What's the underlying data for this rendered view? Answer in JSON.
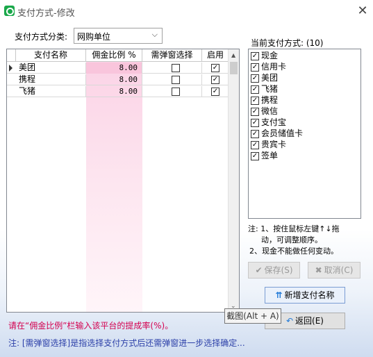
{
  "window": {
    "title": "支付方式-修改",
    "close_glyph": "✕"
  },
  "category": {
    "label": "支付方式分类:",
    "value": "网购单位"
  },
  "table": {
    "headers": [
      "支付名称",
      "佣金比例 %",
      "需弹窗选择",
      "启用"
    ],
    "rows": [
      {
        "name": "美团",
        "rate": "8.00",
        "popup": false,
        "enabled": true
      },
      {
        "name": "携程",
        "rate": "8.00",
        "popup": false,
        "enabled": true
      },
      {
        "name": "飞猪",
        "rate": "8.00",
        "popup": false,
        "enabled": true
      }
    ]
  },
  "current": {
    "title": "当前支付方式: (10)",
    "items": [
      {
        "label": "现金",
        "checked": true
      },
      {
        "label": "信用卡",
        "checked": true
      },
      {
        "label": "美团",
        "checked": true
      },
      {
        "label": "飞猪",
        "checked": true
      },
      {
        "label": "携程",
        "checked": true
      },
      {
        "label": "微信",
        "checked": true
      },
      {
        "label": "支付宝",
        "checked": true
      },
      {
        "label": "会员储值卡",
        "checked": true
      },
      {
        "label": "贵宾卡",
        "checked": true
      },
      {
        "label": "签单",
        "checked": true
      }
    ]
  },
  "notes": {
    "line1": "注: 1、按住鼠标左键↑↓拖",
    "line2": "动，可调整顺序。",
    "line3": "2、现金不能做任何变动。"
  },
  "buttons": {
    "save": "保存(S)",
    "cancel": "取消(C)",
    "add": "新增支付名称",
    "back": "返回(E)"
  },
  "tooltip": "截图(Alt + A)",
  "footer": {
    "red": "请在“佣金比例”栏输入该平台的提成率(%)。",
    "blue": "注: [需弹窗选择]是指选择支付方式后还需弹窗进一步选择确定..."
  },
  "icons": {
    "app": "app-logo-icon",
    "save": "check-icon",
    "cancel": "x-icon",
    "add": "up-arrows-icon",
    "back": "return-icon"
  }
}
